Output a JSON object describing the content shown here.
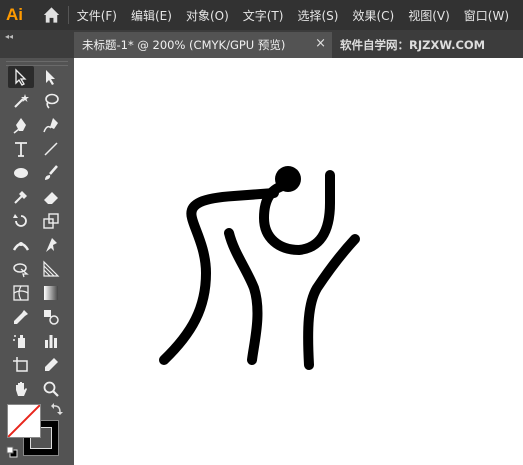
{
  "app": {
    "logo_text": "Ai"
  },
  "menu": {
    "items": [
      "文件(F)",
      "编辑(E)",
      "对象(O)",
      "文字(T)",
      "选择(S)",
      "效果(C)",
      "视图(V)",
      "窗口(W)"
    ]
  },
  "tabs": [
    {
      "title": "未标题-1* @ 200% (CMYK/GPU 预览)",
      "close": "×",
      "active": true
    },
    {
      "title": "软件自学网：RJZXW.COM",
      "active": false
    }
  ],
  "panel": {
    "collapse_glyph": "◂◂"
  },
  "toolbar": {
    "tools": [
      "selection-tool",
      "direct-selection-tool",
      "magic-wand-tool",
      "lasso-tool",
      "pen-tool",
      "curvature-tool",
      "type-tool",
      "line-segment-tool",
      "ellipse-tool",
      "paintbrush-tool",
      "shaper-tool",
      "eraser-tool",
      "rotate-tool",
      "scale-tool",
      "width-tool",
      "puppet-warp-tool",
      "shape-builder-tool",
      "perspective-grid-tool",
      "mesh-tool",
      "gradient-tool",
      "eyedropper-tool",
      "blend-tool",
      "symbol-sprayer-tool",
      "column-graph-tool",
      "artboard-tool",
      "slice-tool",
      "hand-tool",
      "zoom-tool"
    ],
    "fill": "none",
    "stroke": "#000000"
  },
  "colors": {
    "accent": "#ff9a00",
    "menubar": "#323232",
    "panel": "#535353",
    "canvas": "#ffffff"
  }
}
